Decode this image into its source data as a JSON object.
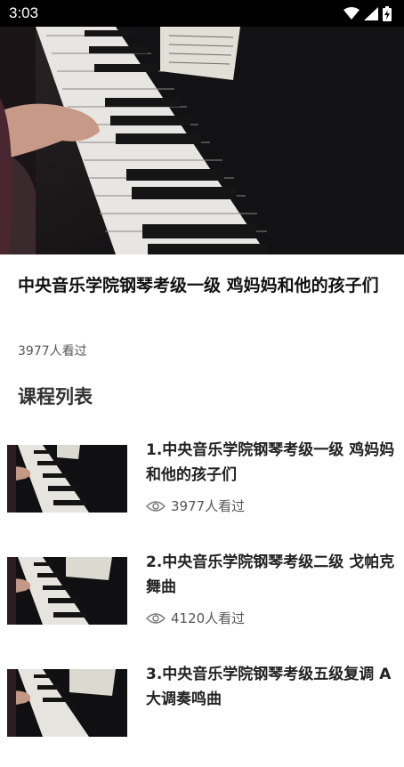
{
  "status_bar": {
    "time": "3:03"
  },
  "video": {
    "title": "中央音乐学院钢琴考级一级 鸡妈妈和他的孩子们",
    "views": "3977人看过"
  },
  "section": {
    "title": "课程列表"
  },
  "courses": [
    {
      "title": "1.中央音乐学院钢琴考级一级 鸡妈妈和他的孩子们",
      "views": "3977人看过"
    },
    {
      "title": "2.中央音乐学院钢琴考级二级 戈帕克舞曲",
      "views": "4120人看过"
    },
    {
      "title": "3.中央音乐学院钢琴考级五级复调 A大调奏鸣曲",
      "views": ""
    }
  ]
}
